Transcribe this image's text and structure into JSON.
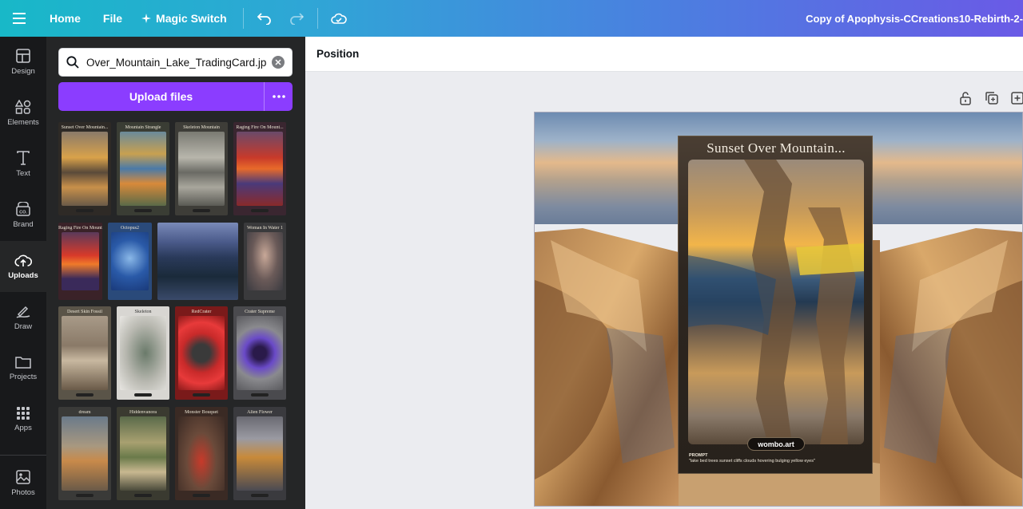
{
  "topbar": {
    "menu_icon": "hamburger-icon",
    "home": "Home",
    "file": "File",
    "magic_switch": "Magic Switch",
    "undo_icon": "undo-icon",
    "redo_icon": "redo-icon",
    "cloud_icon": "cloud-sync-icon",
    "doc_title": "Copy of Apophysis-CCreations10-Rebirth-2-"
  },
  "rail": {
    "items": [
      {
        "label": "Design",
        "icon": "layout-icon"
      },
      {
        "label": "Elements",
        "icon": "shapes-icon"
      },
      {
        "label": "Text",
        "icon": "text-icon"
      },
      {
        "label": "Brand",
        "icon": "brand-icon"
      },
      {
        "label": "Uploads",
        "icon": "cloud-upload-icon"
      },
      {
        "label": "Draw",
        "icon": "pen-icon"
      },
      {
        "label": "Projects",
        "icon": "folder-icon"
      },
      {
        "label": "Apps",
        "icon": "apps-grid-icon"
      },
      {
        "label": "Photos",
        "icon": "image-icon"
      }
    ],
    "active": "Uploads"
  },
  "panel": {
    "search_value": "Over_Mountain_Lake_TradingCard.jpg",
    "upload_label": "Upload files",
    "thumbnails": [
      {
        "caption": "Sunset Over Mountain..."
      },
      {
        "caption": "Mountain Strangle"
      },
      {
        "caption": "Skeleton Mountain"
      },
      {
        "caption": "Raging Fire On Mount..."
      },
      {
        "caption": "Raging Fire On Mount..."
      },
      {
        "caption": "Octopus2"
      },
      {
        "caption": ""
      },
      {
        "caption": "Woman In Water 1"
      },
      {
        "caption": "Desert Skin Fossil"
      },
      {
        "caption": "Skeleton"
      },
      {
        "caption": "RedCrater"
      },
      {
        "caption": "Crater Supreme"
      },
      {
        "caption": "dream"
      },
      {
        "caption": "Hiddenvanora"
      },
      {
        "caption": "Monster Bouquet"
      },
      {
        "caption": "Alien Flower"
      }
    ]
  },
  "context_bar": {
    "position": "Position"
  },
  "canvas": {
    "card_title": "Sunset Over Mountain...",
    "badge": "wombo.art",
    "prompt_label": "PROMPT",
    "prompt_text": "\"lake bed trees sunset cliffs clouds hovering bulging yellow eyes\""
  }
}
